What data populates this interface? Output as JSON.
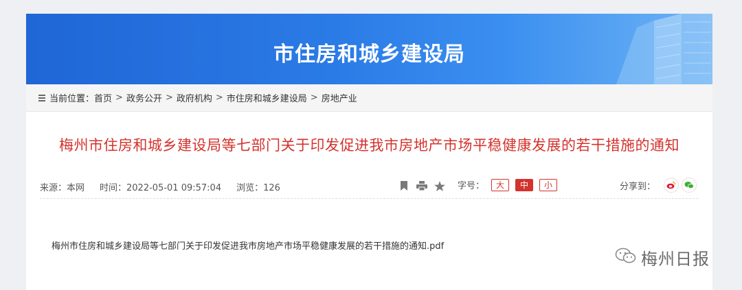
{
  "banner": {
    "title": "市住房和城乡建设局"
  },
  "breadcrumb": {
    "prefix": "当前位置：",
    "items": [
      "首页",
      "政务公开",
      "政府机构",
      "市住房和城乡建设局",
      "房地产业"
    ],
    "separator": ">"
  },
  "article": {
    "title": "梅州市住房和城乡建设局等七部门关于印发促进我市房地产市场平稳健康发展的若干措施的通知",
    "source": "来源：本网",
    "time": "时间：2022-05-01 09:57:04",
    "views": "浏览：126",
    "attachment": "梅州市住房和城乡建设局等七部门关于印发促进我市房地产市场平稳健康发展的若干措施的通知.pdf"
  },
  "toolbar": {
    "icons": [
      "bookmark-icon",
      "print-icon",
      "star-icon"
    ],
    "fontsize_label": "字号：",
    "fontsize_large": "大",
    "fontsize_medium": "中",
    "fontsize_small": "小",
    "share_label": "分享到："
  },
  "watermark": {
    "text": "梅州日报"
  },
  "colors": {
    "accent": "#d4322c",
    "banner": "#2b7be6"
  }
}
